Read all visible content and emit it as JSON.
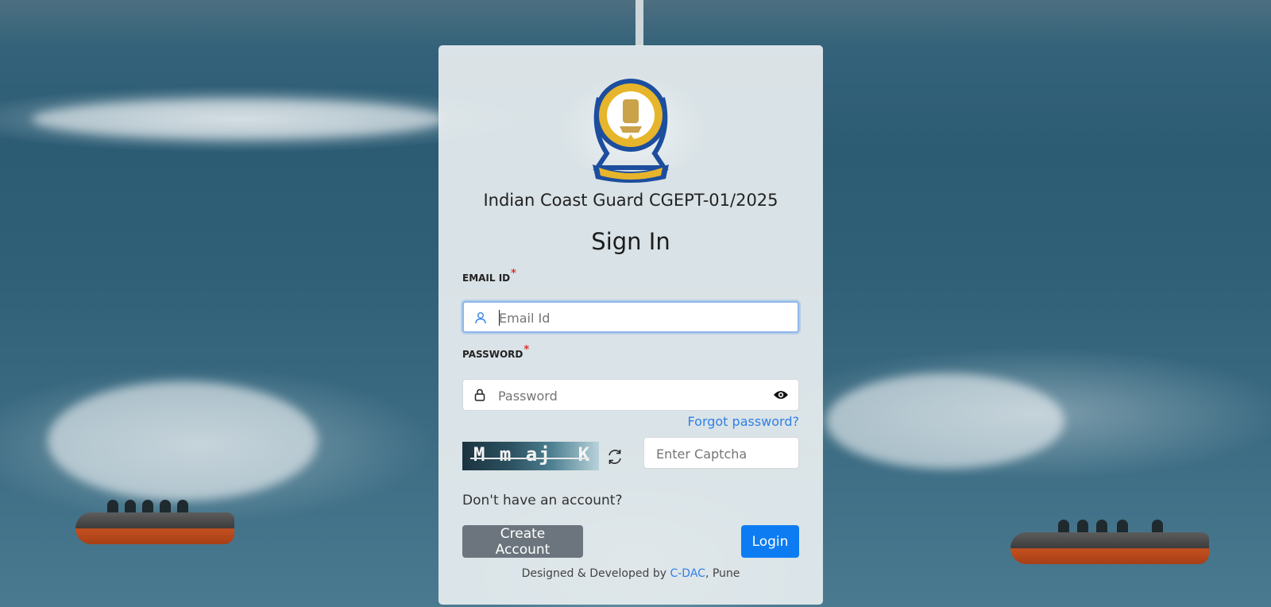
{
  "header": {
    "organization_title": "Indian Coast Guard CGEPT-01/2025",
    "page_title": "Sign In"
  },
  "form": {
    "email": {
      "label": "EMAIL ID",
      "required_mark": "*",
      "placeholder": "Email Id",
      "value": ""
    },
    "password": {
      "label": "PASSWORD",
      "required_mark": "*",
      "placeholder": "Password",
      "value": ""
    },
    "forgot_password_link": "Forgot password?",
    "captcha": {
      "image_text": "M m aj  K",
      "placeholder": "Enter Captcha",
      "value": ""
    }
  },
  "account": {
    "prompt": "Don't have an account?",
    "create_account_button": "Create Account",
    "login_button": "Login"
  },
  "footer": {
    "prefix": "Designed & Developed by ",
    "developer_link": "C-DAC",
    "suffix": ", Pune"
  },
  "colors": {
    "primary": "#0d7cf2",
    "secondary": "#6c757d",
    "link": "#2f7fe8",
    "required": "#d9362b"
  },
  "icons": {
    "email": "user-icon",
    "password": "lock-icon",
    "visibility": "eye-icon",
    "captcha_refresh": "refresh-icon"
  }
}
